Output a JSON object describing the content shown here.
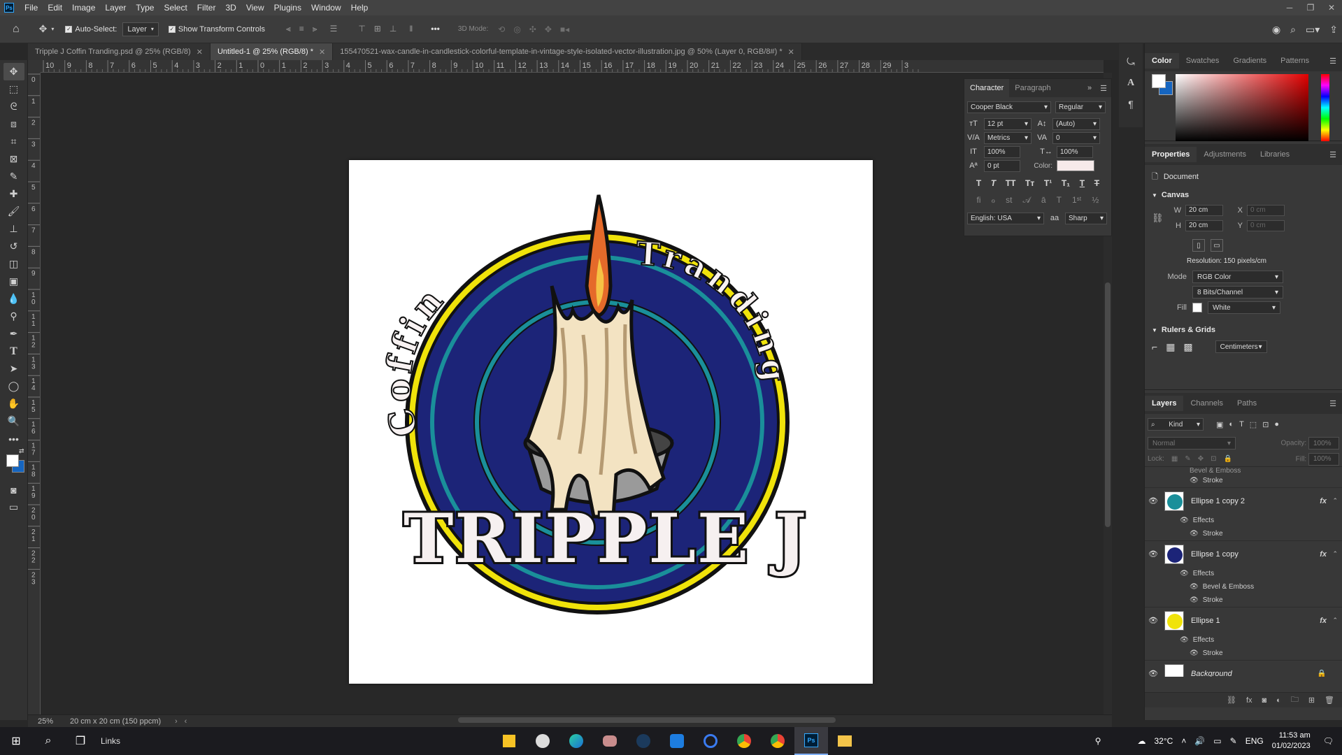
{
  "menu": {
    "items": [
      "File",
      "Edit",
      "Image",
      "Layer",
      "Type",
      "Select",
      "Filter",
      "3D",
      "View",
      "Plugins",
      "Window",
      "Help"
    ]
  },
  "options_bar": {
    "auto_select_label": "Auto-Select:",
    "auto_select_target": "Layer",
    "transform_label": "Show Transform Controls",
    "mode_3d_label": "3D Mode:"
  },
  "tabs": [
    {
      "label": "Tripple J Coffin Tranding.psd @ 25% (RGB/8)",
      "active": false
    },
    {
      "label": "Untitled-1 @ 25% (RGB/8) *",
      "active": true
    },
    {
      "label": "155470521-wax-candle-in-candlestick-colorful-template-in-vintage-style-isolated-vector-illustration.jpg @ 50% (Layer 0, RGB/8#) *",
      "active": false
    }
  ],
  "ruler": {
    "top_labels": [
      "10",
      "9",
      "8",
      "7",
      "6",
      "5",
      "4",
      "3",
      "2",
      "1",
      "0",
      "1",
      "2",
      "3",
      "4",
      "5",
      "6",
      "7",
      "8",
      "9",
      "10",
      "11",
      "12",
      "13",
      "14",
      "15",
      "16",
      "17",
      "18",
      "19",
      "20",
      "21",
      "22",
      "23",
      "24",
      "25",
      "26",
      "27",
      "28",
      "29",
      "3"
    ],
    "left_labels": [
      "0",
      "1",
      "2",
      "3",
      "4",
      "5",
      "6",
      "7",
      "8",
      "9",
      "10",
      "11",
      "12",
      "13",
      "14",
      "15",
      "16",
      "17",
      "18",
      "19",
      "20",
      "21",
      "22",
      "23"
    ]
  },
  "artwork": {
    "arc_left": "Coffin",
    "arc_right": "Tranding",
    "brand": "TRIPPLE J",
    "colors": {
      "navy": "#1c2478",
      "teal": "#1a8f9a",
      "yellow": "#f0e30a",
      "cream": "#f3e3c2",
      "flame": "#e56a2a"
    }
  },
  "status": {
    "zoom": "25%",
    "dims": "20 cm x 20 cm (150 ppcm)"
  },
  "character": {
    "tabs": [
      "Character",
      "Paragraph"
    ],
    "font": "Cooper Black",
    "style": "Regular",
    "size": "12 pt",
    "leading": "(Auto)",
    "kerning": "Metrics",
    "tracking": "0",
    "vscale": "100%",
    "hscale": "100%",
    "baseline": "0 pt",
    "color_label": "Color:",
    "language": "English: USA",
    "aa_label": "aa",
    "antialias": "Sharp"
  },
  "color_panel": {
    "tabs": [
      "Color",
      "Swatches",
      "Gradients",
      "Patterns"
    ]
  },
  "properties": {
    "tabs": [
      "Properties",
      "Adjustments",
      "Libraries"
    ],
    "doc_label": "Document",
    "canvas_heading": "Canvas",
    "w_label": "W",
    "w_value": "20 cm",
    "h_label": "H",
    "h_value": "20 cm",
    "x_label": "X",
    "x_placeholder": "0 cm",
    "y_label": "Y",
    "y_placeholder": "0 cm",
    "resolution": "Resolution: 150 pixels/cm",
    "mode_label": "Mode",
    "mode": "RGB Color",
    "bits": "8 Bits/Channel",
    "fill_label": "Fill",
    "fill": "White",
    "rulers_heading": "Rulers & Grids",
    "units": "Centimeters"
  },
  "layers": {
    "tabs": [
      "Layers",
      "Channels",
      "Paths"
    ],
    "kind": "Kind",
    "blend": "Normal",
    "opacity_label": "Opacity:",
    "opacity": "100%",
    "lock_label": "Lock:",
    "fill_label": "Fill:",
    "fill": "100%",
    "top_partial": "Bevel & Emboss",
    "top_stroke": "Stroke",
    "effects_label": "Effects",
    "stroke_label": "Stroke",
    "bevel_label": "Bevel & Emboss",
    "items": [
      {
        "name": "Ellipse 1 copy 2"
      },
      {
        "name": "Ellipse 1 copy"
      },
      {
        "name": "Ellipse 1"
      },
      {
        "name": "Background"
      }
    ]
  },
  "taskbar": {
    "links_label": "Links",
    "temperature": "32°C",
    "language": "ENG",
    "time": "11:53 am",
    "date": "01/02/2023"
  }
}
